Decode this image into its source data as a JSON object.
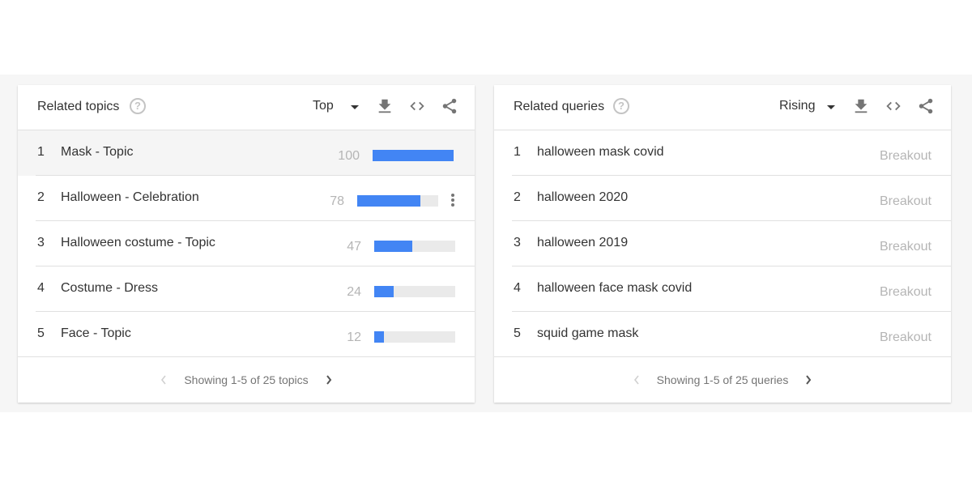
{
  "colors": {
    "accent_bar": "#4285f4",
    "bar_track": "#eaeaea",
    "band_background": "#f6f6f6"
  },
  "topics": {
    "title": "Related topics",
    "help_icon": "help-circle-icon",
    "selector_value": "Top",
    "icons": [
      "download-icon",
      "embed-code-icon",
      "share-icon"
    ],
    "rows": [
      {
        "rank": "1",
        "label": "Mask - Topic",
        "value": "100",
        "percent": 100
      },
      {
        "rank": "2",
        "label": "Halloween - Celebration",
        "value": "78",
        "percent": 78
      },
      {
        "rank": "3",
        "label": "Halloween costume - Topic",
        "value": "47",
        "percent": 47
      },
      {
        "rank": "4",
        "label": "Costume - Dress",
        "value": "24",
        "percent": 24
      },
      {
        "rank": "5",
        "label": "Face - Topic",
        "value": "12",
        "percent": 12
      }
    ],
    "pagination": "Showing 1-5 of 25 topics"
  },
  "queries": {
    "title": "Related queries",
    "help_icon": "help-circle-icon",
    "selector_value": "Rising",
    "icons": [
      "download-icon",
      "embed-code-icon",
      "share-icon"
    ],
    "rows": [
      {
        "rank": "1",
        "label": "halloween mask covid",
        "value": "Breakout"
      },
      {
        "rank": "2",
        "label": "halloween 2020",
        "value": "Breakout"
      },
      {
        "rank": "3",
        "label": "halloween 2019",
        "value": "Breakout"
      },
      {
        "rank": "4",
        "label": "halloween face mask covid",
        "value": "Breakout"
      },
      {
        "rank": "5",
        "label": "squid game mask",
        "value": "Breakout"
      }
    ],
    "pagination": "Showing 1-5 of 25 queries"
  }
}
